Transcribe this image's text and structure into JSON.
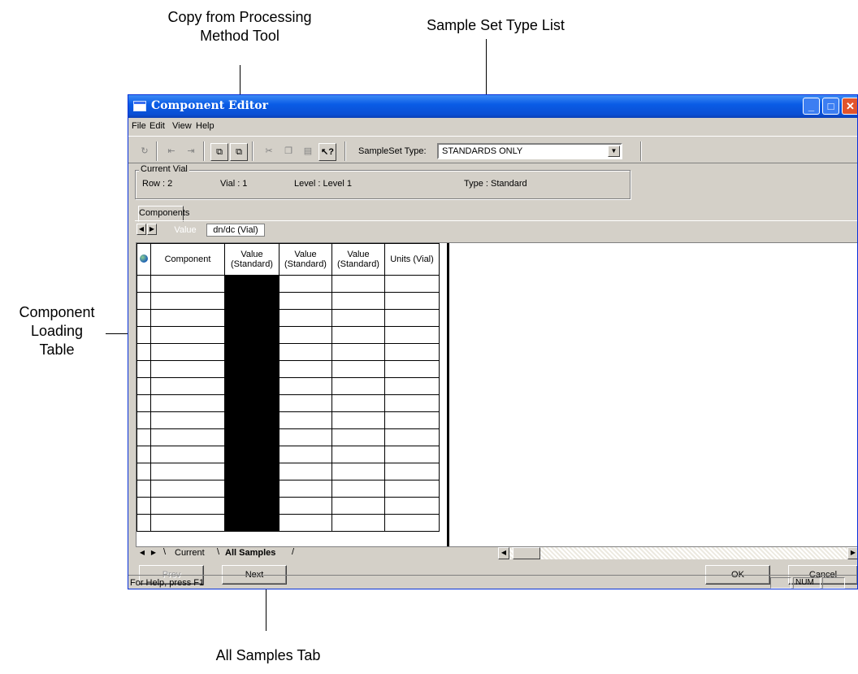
{
  "callouts": {
    "copy_tool": [
      "Copy from Processing",
      "Method Tool"
    ],
    "sample_set_type_list": "Sample Set Type List",
    "component_loading_table": [
      "Component",
      "Loading",
      "Table"
    ],
    "all_samples_tab": "All Samples Tab"
  },
  "window": {
    "title": "Component Editor"
  },
  "menu": [
    "File",
    "Edit",
    "View",
    "Help"
  ],
  "toolbar": {
    "sampleset_label": "SampleSet Type:",
    "sampleset_value": "STANDARDS ONLY"
  },
  "current_vial": {
    "legend": "Current Vial",
    "row": "Row :  2",
    "vial": "Vial :  1",
    "level": "Level :  Level 1",
    "type": "Type :  Standard"
  },
  "tabs": {
    "components": "Components",
    "value": "Value",
    "dndc": "dn/dc (Vial)"
  },
  "grid": {
    "headers": [
      "Component",
      "Value (Standard)",
      "Value (Standard)",
      "Value (Standard)",
      "Units (Vial)"
    ],
    "row_count": 15
  },
  "sheets": {
    "current": "Current",
    "all": "All Samples"
  },
  "buttons": {
    "prev": "Prev",
    "next": "Next",
    "ok": "OK",
    "cancel": "Cancel"
  },
  "status": {
    "message": "For Help, press F1",
    "num": "NUM"
  }
}
